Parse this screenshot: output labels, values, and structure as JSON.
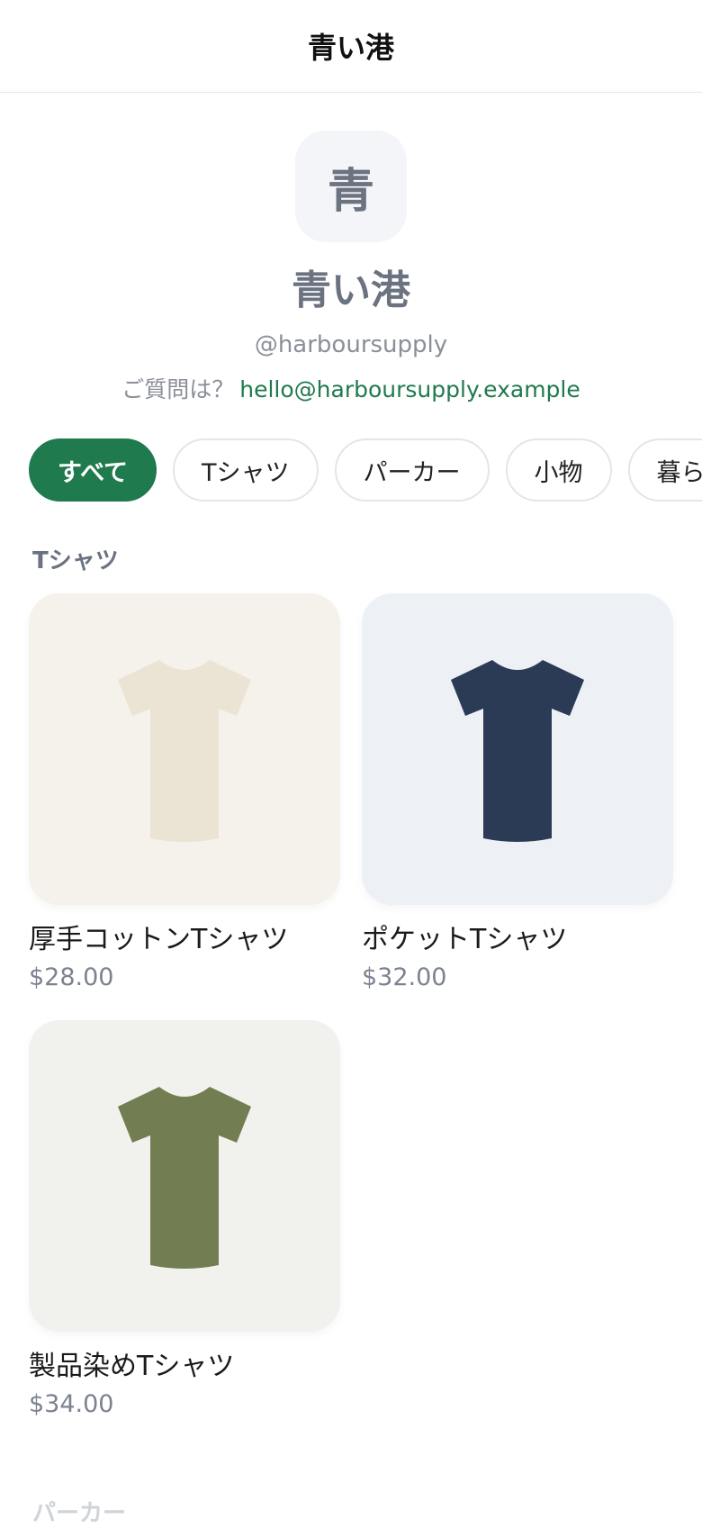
{
  "header": {
    "title": "青い港"
  },
  "profile": {
    "avatar_initial": "青",
    "name": "青い港",
    "handle": "@harboursupply",
    "contact_prefix": "ご質問は？",
    "contact_email": "hello@harboursupply.example"
  },
  "categories": [
    {
      "label": "すべて",
      "active": true
    },
    {
      "label": "Tシャツ",
      "active": false
    },
    {
      "label": "パーカー",
      "active": false
    },
    {
      "label": "小物",
      "active": false
    },
    {
      "label": "暮らし",
      "active": false
    }
  ],
  "sections": [
    {
      "title": "Tシャツ",
      "products": [
        {
          "name": "厚手コットンTシャツ",
          "price": "$28.00",
          "bg": "#f5f1eb",
          "shirt_color": "#ebe3d3",
          "icon": "tshirt-icon"
        },
        {
          "name": "ポケットTシャツ",
          "price": "$32.00",
          "bg": "#edf0f5",
          "shirt_color": "#2b3a55",
          "icon": "tshirt-icon"
        },
        {
          "name": "製品染めTシャツ",
          "price": "$34.00",
          "bg": "#f1f2ee",
          "shirt_color": "#727d52",
          "icon": "tshirt-icon"
        }
      ]
    }
  ],
  "next_section_title": "パーカー",
  "colors": {
    "accent": "#1f7a4d",
    "muted_text": "#6b7280"
  }
}
